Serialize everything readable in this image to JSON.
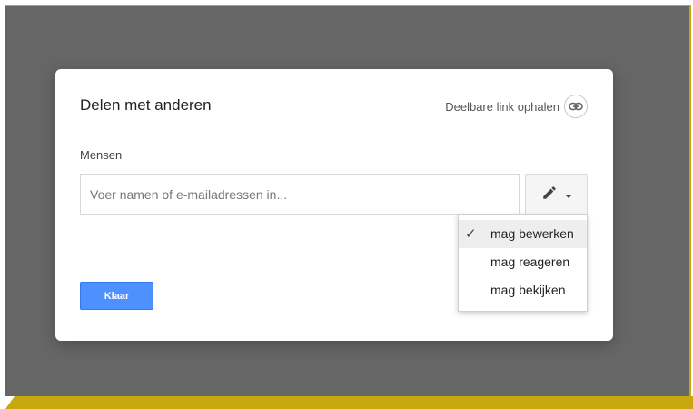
{
  "dialog": {
    "title": "Delen met anderen",
    "share_link_label": "Deelbare link ophalen",
    "share_link_icon": "link-icon",
    "people_label": "Mensen",
    "people_input": {
      "value": "",
      "placeholder": "Voer namen of e-mailadressen in..."
    },
    "permission_button_icon": "pencil-icon",
    "permission_menu": {
      "items": [
        {
          "label": "mag bewerken",
          "selected": true
        },
        {
          "label": "mag reageren",
          "selected": false
        },
        {
          "label": "mag bekijken",
          "selected": false
        }
      ],
      "selected_icon": "check-icon"
    },
    "done_label": "Klaar"
  },
  "colors": {
    "backdrop": "#666666",
    "frame_accent": "#c6a70e",
    "primary_button": "#4d90fe",
    "menu_highlight": "#eeeeee"
  }
}
